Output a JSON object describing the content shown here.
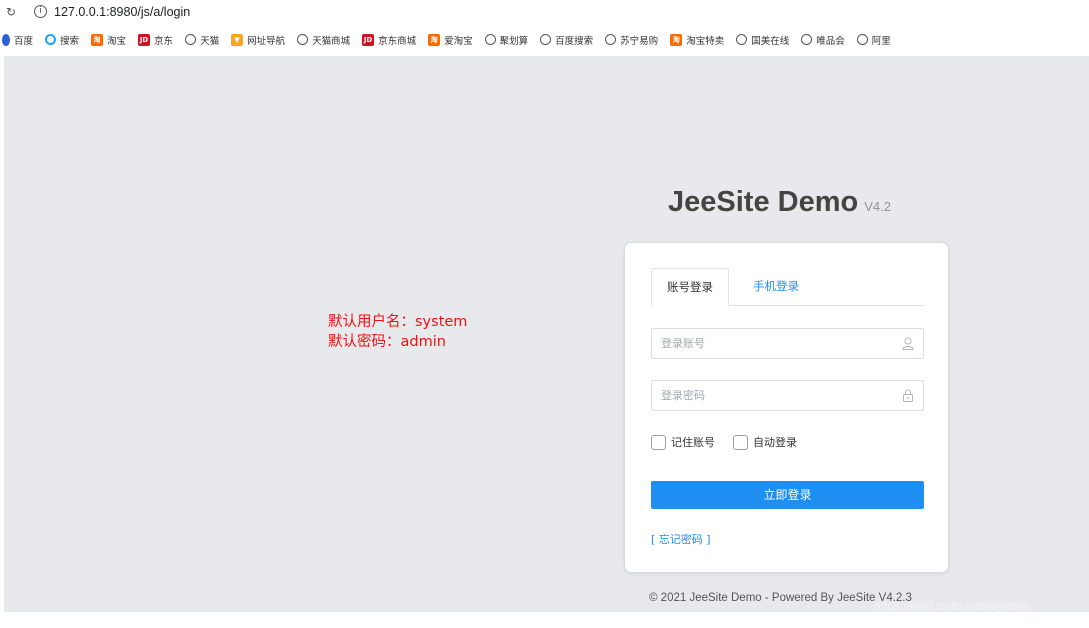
{
  "browser": {
    "url": "127.0.0.1:8980/js/a/login",
    "bookmarks": [
      {
        "label": "百度",
        "icon": "baidu-icon"
      },
      {
        "label": "搜索",
        "icon": "search-icon"
      },
      {
        "label": "淘宝",
        "icon": "taobao-icon"
      },
      {
        "label": "京东",
        "icon": "jd-icon"
      },
      {
        "label": "天猫",
        "icon": "globe-icon"
      },
      {
        "label": "网址导航",
        "icon": "nav-icon"
      },
      {
        "label": "天猫商城",
        "icon": "globe-icon"
      },
      {
        "label": "京东商城",
        "icon": "jd-icon"
      },
      {
        "label": "爱淘宝",
        "icon": "taobao-icon"
      },
      {
        "label": "聚划算",
        "icon": "globe-icon"
      },
      {
        "label": "百度搜索",
        "icon": "globe-icon"
      },
      {
        "label": "苏宁易购",
        "icon": "globe-icon"
      },
      {
        "label": "淘宝特卖",
        "icon": "taobao-icon"
      },
      {
        "label": "国美在线",
        "icon": "globe-icon"
      },
      {
        "label": "唯品会",
        "icon": "globe-icon"
      },
      {
        "label": "阿里",
        "icon": "globe-icon"
      }
    ]
  },
  "note": {
    "line1": "默认用户名：system",
    "line2": "默认密码：admin"
  },
  "brand": {
    "title": "JeeSite Demo",
    "version": "V4.2"
  },
  "login": {
    "tab_account": "账号登录",
    "tab_phone": "手机登录",
    "username_placeholder": "登录账号",
    "password_placeholder": "登录密码",
    "remember_label": "记住账号",
    "auto_login_label": "自动登录",
    "submit_label": "立即登录",
    "forgot_label": "[ 忘记密码 ]"
  },
  "footer": {
    "text": "© 2021 JeeSite Demo - Powered By JeeSite V4.2.3"
  },
  "watermark": "https://blog.csdn.net/ouyicmn",
  "colors": {
    "accent": "#1e8ff0",
    "note_red": "#f01010",
    "page_bg": "#e8e9ec"
  }
}
